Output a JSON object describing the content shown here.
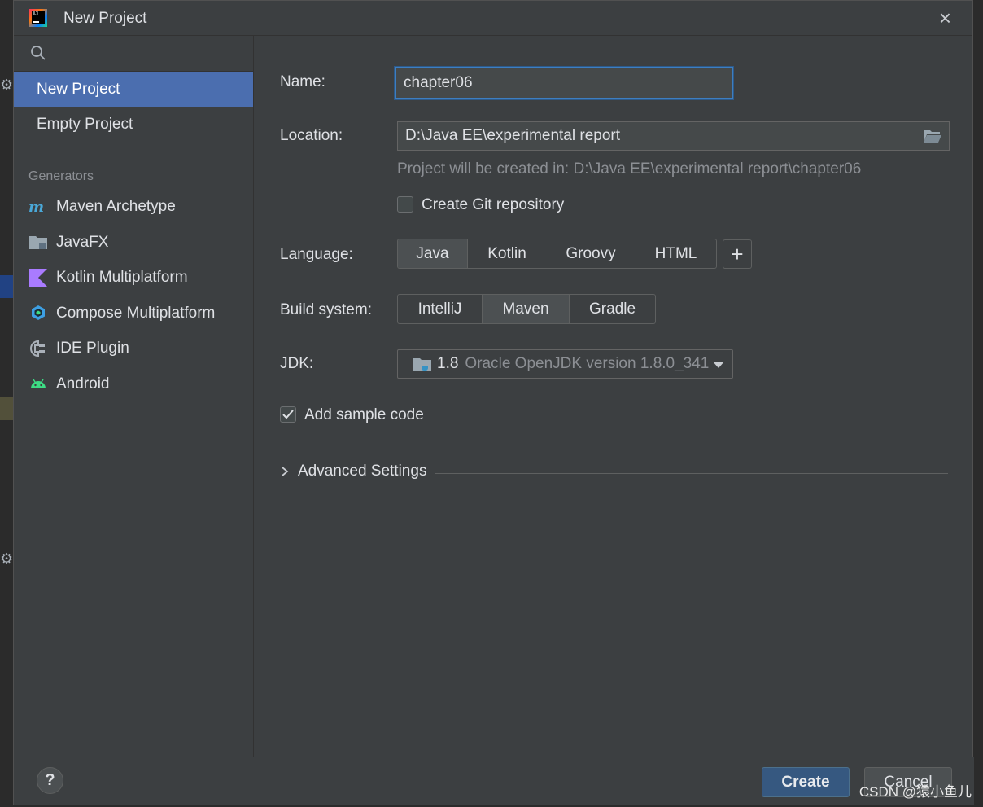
{
  "window": {
    "title": "New Project",
    "close_label": "×"
  },
  "sidebar": {
    "search_placeholder": "",
    "items": [
      {
        "label": "New Project",
        "selected": true
      },
      {
        "label": "Empty Project",
        "selected": false
      }
    ],
    "generators_label": "Generators",
    "generators": [
      {
        "label": "Maven Archetype",
        "icon": "maven-icon"
      },
      {
        "label": "JavaFX",
        "icon": "folder-icon"
      },
      {
        "label": "Kotlin Multiplatform",
        "icon": "kotlin-icon"
      },
      {
        "label": "Compose Multiplatform",
        "icon": "compose-icon"
      },
      {
        "label": "IDE Plugin",
        "icon": "plugin-icon"
      },
      {
        "label": "Android",
        "icon": "android-icon"
      }
    ]
  },
  "form": {
    "name_label": "Name:",
    "name_value": "chapter06",
    "location_label": "Location:",
    "location_value": "D:\\Java EE\\experimental report",
    "location_hint": "Project will be created in: D:\\Java EE\\experimental report\\chapter06",
    "git_label": "Create Git repository",
    "git_checked": false,
    "language_label": "Language:",
    "languages": [
      "Java",
      "Kotlin",
      "Groovy",
      "HTML"
    ],
    "language_selected": "Java",
    "plus_label": "+",
    "build_label": "Build system:",
    "build_systems": [
      "IntelliJ",
      "Maven",
      "Gradle"
    ],
    "build_selected": "Maven",
    "jdk_label": "JDK:",
    "jdk_version": "1.8",
    "jdk_desc": "Oracle OpenJDK version 1.8.0_341",
    "sample_label": "Add sample code",
    "sample_checked": true,
    "advanced_label": "Advanced Settings"
  },
  "footer": {
    "help_label": "?",
    "create_label": "Create",
    "cancel_label": "Cancel"
  },
  "watermark": "CSDN @猿小鱼儿",
  "colors": {
    "accent": "#4b6eaf",
    "primary_button": "#365880",
    "focus": "#3d7ec1"
  }
}
